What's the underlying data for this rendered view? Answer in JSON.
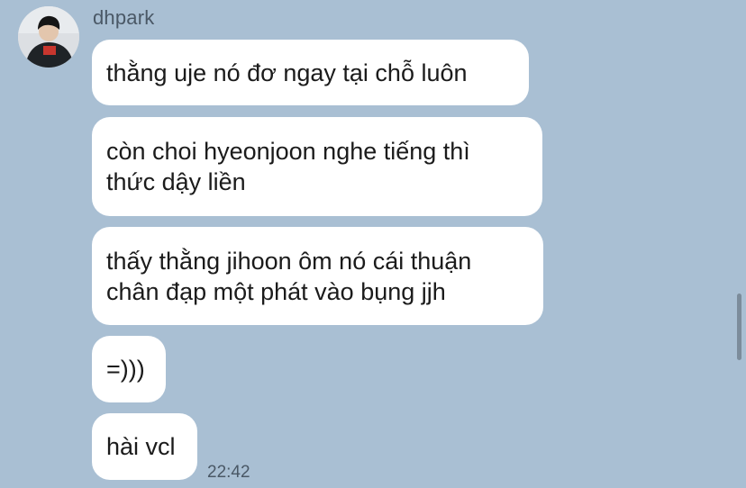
{
  "chat": {
    "sender_name": "dhpark",
    "avatar_icon": "user-avatar-photo",
    "messages": [
      {
        "lines": [
          "thằng uje nó đơ ngay tại chỗ luôn"
        ]
      },
      {
        "lines": [
          "còn choi hyeonjoon nghe tiếng thì",
          "thức dậy liền"
        ]
      },
      {
        "lines": [
          "thấy thằng jihoon ôm nó cái thuận",
          "chân đạp một phát vào bụng jjh"
        ]
      },
      {
        "lines": [
          "=)))"
        ]
      },
      {
        "lines": [
          "hài vcl"
        ]
      }
    ],
    "last_timestamp": "22:42"
  },
  "colors": {
    "background": "#a9bfd3",
    "bubble": "#ffffff",
    "text": "#1b1b1b",
    "meta_text": "#4a5866"
  }
}
